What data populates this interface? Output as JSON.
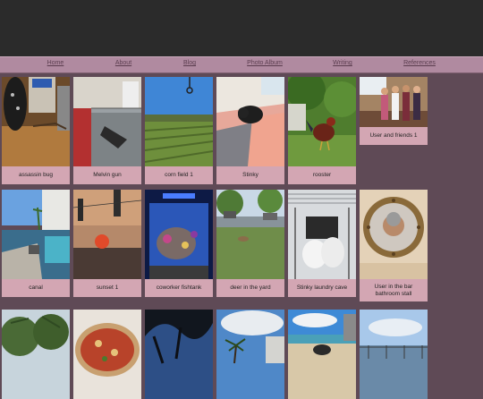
{
  "nav": {
    "items": [
      "Home",
      "About",
      "Blog",
      "Photo Album",
      "Writing",
      "References"
    ]
  },
  "gallery": {
    "row1": [
      {
        "caption": "assassin bug",
        "icon": "assassin-bug-photo"
      },
      {
        "caption": "Melvin gun",
        "icon": "melvin-gun-photo"
      },
      {
        "caption": "corn field 1",
        "icon": "corn-field-photo"
      },
      {
        "caption": "Stinky",
        "icon": "stinky-cat-photo"
      },
      {
        "caption": "rooster",
        "icon": "rooster-photo"
      },
      {
        "caption": "User and friends 1",
        "icon": "friends-photo"
      }
    ],
    "row2": [
      {
        "caption": "canal",
        "icon": "canal-photo"
      },
      {
        "caption": "sunset 1",
        "icon": "sunset-photo"
      },
      {
        "caption": "coworker fishtank",
        "icon": "fishtank-photo"
      },
      {
        "caption": "deer in the yard",
        "icon": "deer-photo"
      },
      {
        "caption": "Stinky laundry cave",
        "icon": "laundry-photo"
      },
      {
        "caption": "User in the bar bathroom stall",
        "icon": "porthole-photo"
      }
    ],
    "row3": [
      {
        "icon": "trees-photo"
      },
      {
        "icon": "pizza-photo"
      },
      {
        "icon": "night-tree-photo"
      },
      {
        "icon": "palm-cloud-photo"
      },
      {
        "icon": "beach-photo"
      },
      {
        "icon": "waterfront-photo"
      }
    ]
  },
  "colors": {
    "background": "#5f4a56",
    "nav_bar": "#b08aa0",
    "caption_bg": "#d3a6b3",
    "top_bar": "#2b2b2b"
  }
}
